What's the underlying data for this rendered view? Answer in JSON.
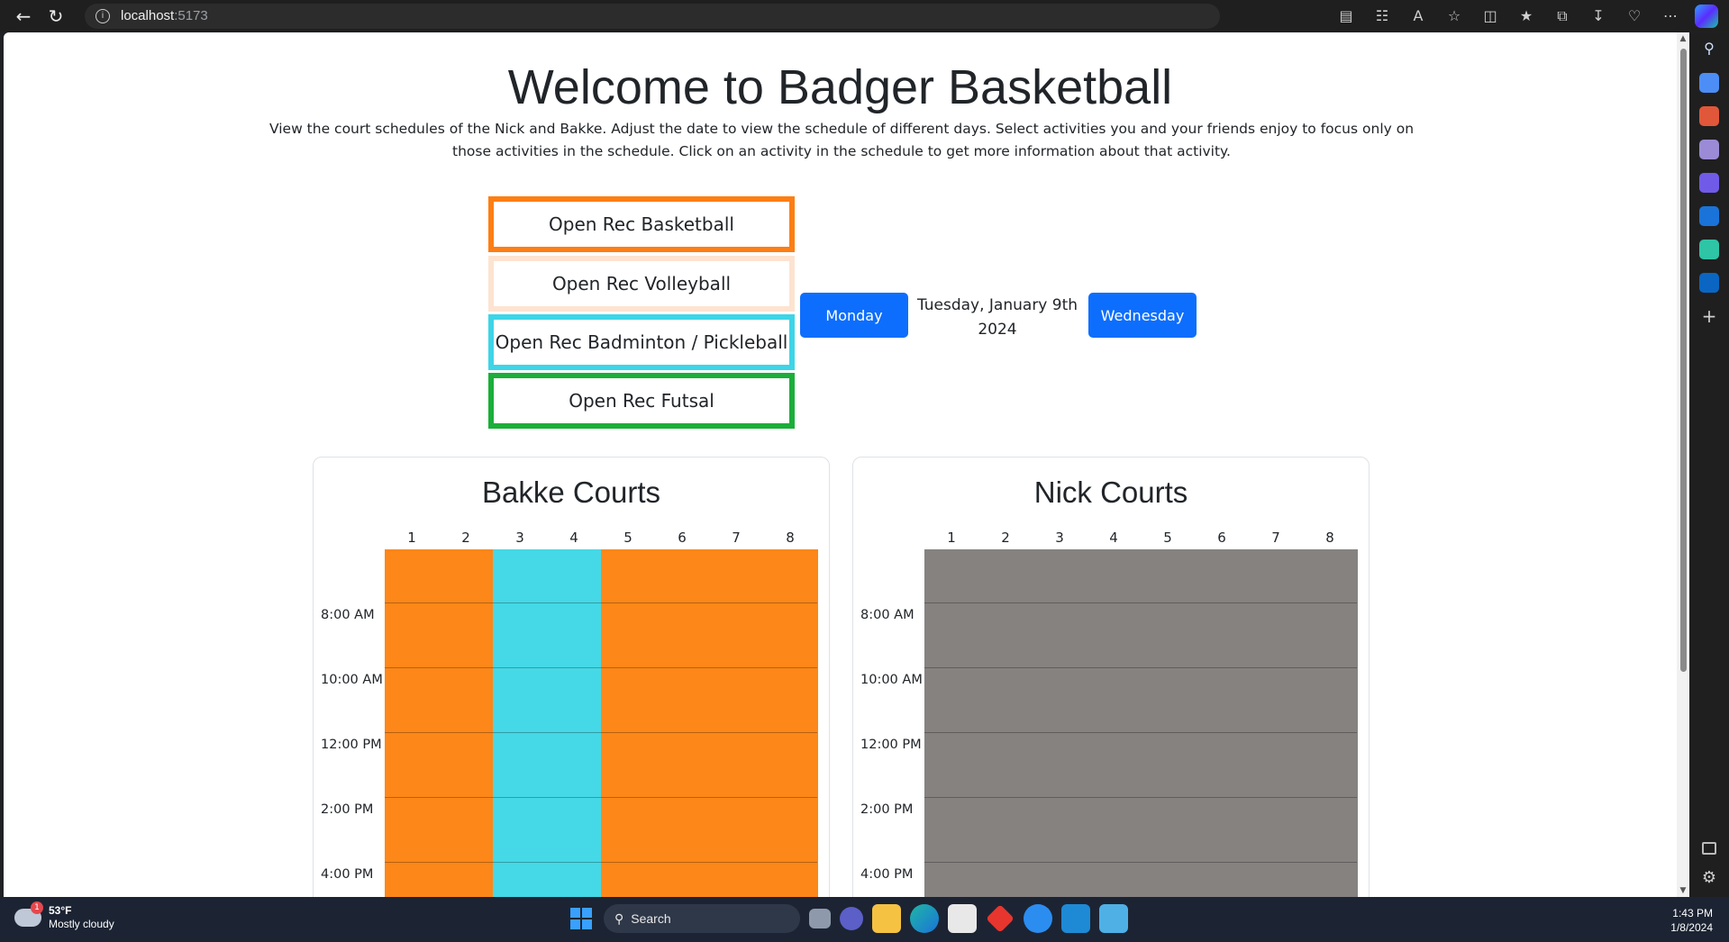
{
  "browser": {
    "host": "localhost",
    "port": ":5173",
    "info_glyph": "i"
  },
  "page": {
    "title": "Welcome to Badger Basketball",
    "description": "View the court schedules of the Nick and Bakke. Adjust the date to view the schedule of different days. Select activities you and your friends enjoy to focus only on those activities in the schedule. Click on an activity in the schedule to get more information about that activity."
  },
  "filters": [
    {
      "label": "Open Rec Basketball",
      "color": "#fd7e14"
    },
    {
      "label": "Open Rec Volleyball",
      "color": "#fde3d0"
    },
    {
      "label": "Open Rec Badminton / Pickleball",
      "color": "#3dd5e7"
    },
    {
      "label": "Open Rec Futsal",
      "color": "#1bae3a"
    }
  ],
  "date_nav": {
    "prev_label": "Monday",
    "current_line1": "Tuesday, January 9th",
    "current_line2": "2024",
    "next_label": "Wednesday"
  },
  "courts": [
    {
      "title": "Bakke Courts",
      "columns": [
        "1",
        "2",
        "3",
        "4",
        "5",
        "6",
        "7",
        "8"
      ],
      "column_colors": [
        "#fd8718",
        "#fd8718",
        "#45d8e6",
        "#45d8e6",
        "#fd8718",
        "#fd8718",
        "#fd8718",
        "#fd8718"
      ],
      "times": [
        "8:00 AM",
        "10:00 AM",
        "12:00 PM",
        "2:00 PM",
        "4:00 PM"
      ]
    },
    {
      "title": "Nick Courts",
      "columns": [
        "1",
        "2",
        "3",
        "4",
        "5",
        "6",
        "7",
        "8"
      ],
      "column_colors": [
        "#858280",
        "#858280",
        "#858280",
        "#858280",
        "#858280",
        "#858280",
        "#858280",
        "#858280"
      ],
      "times": [
        "8:00 AM",
        "10:00 AM",
        "12:00 PM",
        "2:00 PM",
        "4:00 PM"
      ]
    }
  ],
  "taskbar": {
    "temperature": "53°F",
    "condition": "Mostly cloudy",
    "badge": "1",
    "search_label": "Search",
    "time": "1:43 PM",
    "date": "1/8/2024"
  }
}
